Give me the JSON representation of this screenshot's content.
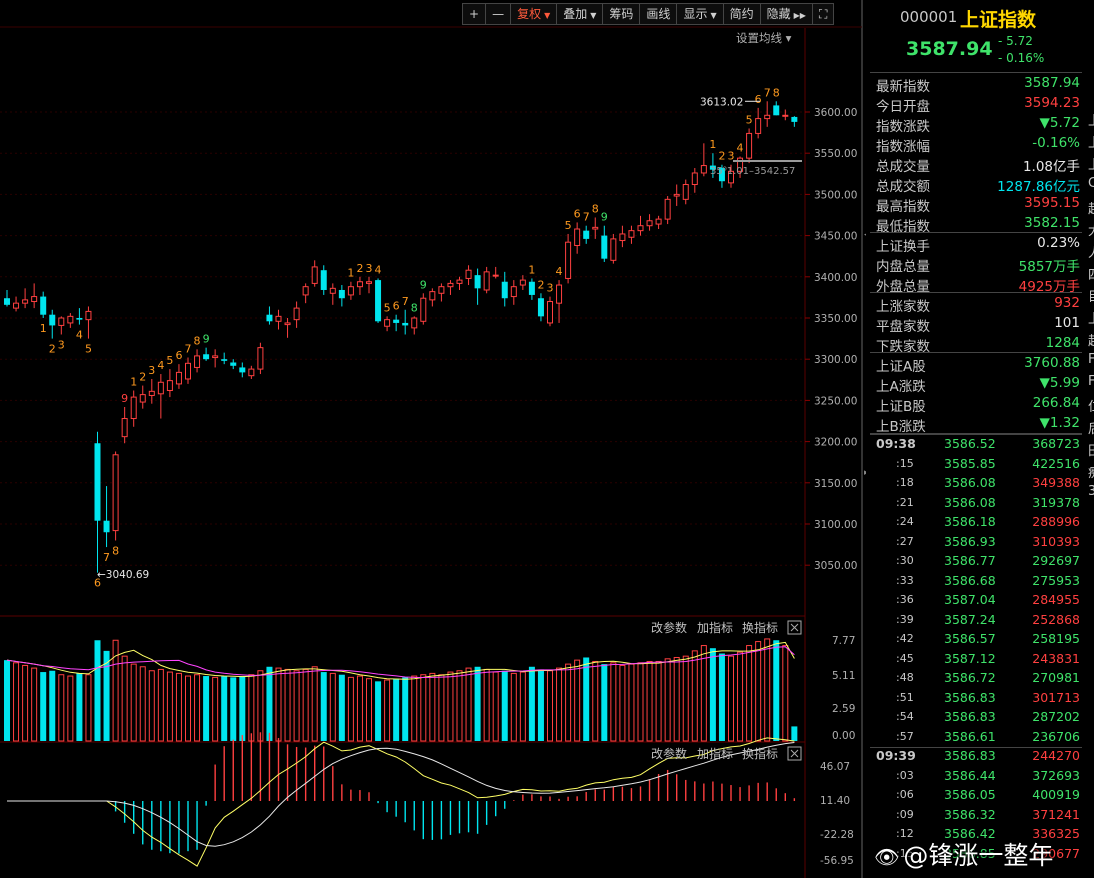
{
  "toolbar": [
    "+",
    "—",
    "复权",
    "叠加",
    "筹码",
    "画线",
    "显示",
    "简约",
    "隐藏",
    "⛶"
  ],
  "toolbar_active": "复权",
  "toolbar_dropdowns": [
    "复权",
    "叠加",
    "显示"
  ],
  "icons": {
    "expand": "expand-icon",
    "hide_arrow": "double-arrow-right-icon",
    "close": "close-icon"
  },
  "colors": {
    "up": "#ff4040",
    "down": "#00e5ee",
    "bg": "#000000",
    "ma5": "#ffff66",
    "ma10": "#ff44ff",
    "label_orange": "#ff9a1f",
    "label_green": "#3fe36a"
  },
  "main": {
    "settings_label": "设置均线",
    "price_axis": [
      "3600.00",
      "3550.00",
      "3500.00",
      "3450.00",
      "3400.00",
      "3350.00",
      "3300.00",
      "3250.00",
      "3200.00",
      "3150.00",
      "3100.00",
      "3050.00"
    ],
    "annotation_high": "3613.02",
    "annotation_low": "3040.69",
    "annotation_range": "35⁰1.01–3542.57"
  },
  "volume": {
    "controls": [
      "改参数",
      "加指标",
      "换指标"
    ],
    "axis": [
      "7.77",
      "5.11",
      "2.59",
      "0.00"
    ]
  },
  "macd": {
    "controls": [
      "改参数",
      "加指标",
      "换指标"
    ],
    "axis": [
      "46.07",
      "11.40",
      "-22.28",
      "-56.95"
    ]
  },
  "quote": {
    "code": "000001",
    "name": "上证指数",
    "price": "3587.94",
    "change": "- 5.72",
    "change_pct": "- 0.16%",
    "rows": [
      {
        "label": "最新指数",
        "value": "3587.94",
        "color": "green"
      },
      {
        "label": "今日开盘",
        "value": "3594.23",
        "color": "red"
      },
      {
        "label": "指数涨跌",
        "value": "▼5.72",
        "color": "green"
      },
      {
        "label": "指数涨幅",
        "value": "-0.16%",
        "color": "green"
      },
      {
        "label": "总成交量",
        "value": "1.08亿手",
        "color": "white"
      },
      {
        "label": "总成交额",
        "value": "1287.86亿元",
        "color": "cyan"
      },
      {
        "label": "最高指数",
        "value": "3595.15",
        "color": "red"
      },
      {
        "label": "最低指数",
        "value": "3582.15",
        "color": "green"
      },
      {
        "label": "上证换手",
        "value": "0.23%",
        "color": "white"
      },
      {
        "label": "内盘总量",
        "value": "5857万手",
        "color": "green"
      },
      {
        "label": "外盘总量",
        "value": "4925万手",
        "color": "red"
      },
      {
        "label": "上涨家数",
        "value": "932",
        "color": "red"
      },
      {
        "label": "平盘家数",
        "value": "101",
        "color": "white"
      },
      {
        "label": "下跌家数",
        "value": "1284",
        "color": "green"
      },
      {
        "label": "上证A股",
        "value": "3760.88",
        "color": "green"
      },
      {
        "label": "上A涨跌",
        "value": "▼5.99",
        "color": "green"
      },
      {
        "label": "上证B股",
        "value": "266.84",
        "color": "green"
      },
      {
        "label": "上B涨跌",
        "value": "▼1.32",
        "color": "green"
      }
    ]
  },
  "ticks": [
    {
      "time": "09:38",
      "price": "3586.52",
      "vol": "368723",
      "vc": "green"
    },
    {
      "time": ":15",
      "price": "3585.85",
      "vol": "422516",
      "vc": "green"
    },
    {
      "time": ":18",
      "price": "3586.08",
      "vol": "349388",
      "vc": "red"
    },
    {
      "time": ":21",
      "price": "3586.08",
      "vol": "319378",
      "vc": "green"
    },
    {
      "time": ":24",
      "price": "3586.18",
      "vol": "288996",
      "vc": "red"
    },
    {
      "time": ":27",
      "price": "3586.93",
      "vol": "310393",
      "vc": "red"
    },
    {
      "time": ":30",
      "price": "3586.77",
      "vol": "292697",
      "vc": "green"
    },
    {
      "time": ":33",
      "price": "3586.68",
      "vol": "275953",
      "vc": "green"
    },
    {
      "time": ":36",
      "price": "3587.04",
      "vol": "284955",
      "vc": "red"
    },
    {
      "time": ":39",
      "price": "3587.24",
      "vol": "252868",
      "vc": "red"
    },
    {
      "time": ":42",
      "price": "3586.57",
      "vol": "258195",
      "vc": "green"
    },
    {
      "time": ":45",
      "price": "3587.12",
      "vol": "243831",
      "vc": "red"
    },
    {
      "time": ":48",
      "price": "3586.72",
      "vol": "270981",
      "vc": "green"
    },
    {
      "time": ":51",
      "price": "3586.83",
      "vol": "301713",
      "vc": "red"
    },
    {
      "time": ":54",
      "price": "3586.83",
      "vol": "287202",
      "vc": "green"
    },
    {
      "time": ":57",
      "price": "3586.61",
      "vol": "236706",
      "vc": "green"
    },
    {
      "time": "09:39",
      "price": "3586.83",
      "vol": "244270",
      "vc": "red"
    },
    {
      "time": ":03",
      "price": "3586.44",
      "vol": "372693",
      "vc": "green"
    },
    {
      "time": ":06",
      "price": "3586.05",
      "vol": "400919",
      "vc": "green"
    },
    {
      "time": ":09",
      "price": "3586.32",
      "vol": "371241",
      "vc": "red"
    },
    {
      "time": ":12",
      "price": "3586.42",
      "vol": "336325",
      "vc": "red"
    },
    {
      "time": ":15",
      "price": "3586.85",
      "vol": "290677",
      "vc": "red"
    }
  ],
  "edge_chars": [
    "上",
    "上",
    "上",
    "C",
    "起",
    "大",
    "人",
    "四",
    "目",
    "上",
    "起",
    "F",
    "F",
    "仁",
    "后",
    "田",
    "痴",
    "3"
  ],
  "watermark": "@锋涨一整年",
  "chart_data": {
    "type": "candlestick",
    "candles": [
      [
        3374,
        3384,
        3364,
        3366
      ],
      [
        3362,
        3376,
        3358,
        3368
      ],
      [
        3368,
        3386,
        3362,
        3372
      ],
      [
        3370,
        3392,
        3362,
        3376
      ],
      [
        3376,
        3382,
        3350,
        3354
      ],
      [
        3354,
        3360,
        3325,
        3341
      ],
      [
        3341,
        3352,
        3330,
        3350
      ],
      [
        3344,
        3356,
        3338,
        3352
      ],
      [
        3350,
        3362,
        3342,
        3348
      ],
      [
        3348,
        3364,
        3325,
        3358
      ],
      [
        3198,
        3212,
        3041,
        3104
      ],
      [
        3104,
        3146,
        3072,
        3090
      ],
      [
        3092,
        3188,
        3080,
        3184
      ],
      [
        3206,
        3242,
        3198,
        3228
      ],
      [
        3228,
        3262,
        3218,
        3254
      ],
      [
        3248,
        3268,
        3240,
        3257
      ],
      [
        3256,
        3276,
        3246,
        3261
      ],
      [
        3258,
        3282,
        3228,
        3272
      ],
      [
        3262,
        3288,
        3254,
        3274
      ],
      [
        3270,
        3294,
        3264,
        3284
      ],
      [
        3276,
        3302,
        3270,
        3295
      ],
      [
        3290,
        3312,
        3284,
        3304
      ],
      [
        3306,
        3314,
        3298,
        3300
      ],
      [
        3302,
        3312,
        3290,
        3304
      ],
      [
        3300,
        3308,
        3294,
        3298
      ],
      [
        3296,
        3300,
        3288,
        3292
      ],
      [
        3290,
        3296,
        3278,
        3284
      ],
      [
        3280,
        3292,
        3276,
        3288
      ],
      [
        3288,
        3320,
        3282,
        3314
      ],
      [
        3354,
        3364,
        3342,
        3346
      ],
      [
        3346,
        3360,
        3336,
        3352
      ],
      [
        3342,
        3350,
        3326,
        3344
      ],
      [
        3348,
        3370,
        3338,
        3362
      ],
      [
        3378,
        3392,
        3368,
        3388
      ],
      [
        3392,
        3420,
        3388,
        3412
      ],
      [
        3408,
        3414,
        3378,
        3384
      ],
      [
        3380,
        3392,
        3366,
        3386
      ],
      [
        3384,
        3390,
        3364,
        3374
      ],
      [
        3378,
        3394,
        3372,
        3388
      ],
      [
        3388,
        3400,
        3378,
        3394
      ],
      [
        3392,
        3400,
        3380,
        3394
      ],
      [
        3396,
        3398,
        3344,
        3346
      ],
      [
        3340,
        3352,
        3334,
        3348
      ],
      [
        3348,
        3354,
        3334,
        3344
      ],
      [
        3344,
        3360,
        3330,
        3341
      ],
      [
        3338,
        3352,
        3330,
        3350
      ],
      [
        3346,
        3380,
        3342,
        3374
      ],
      [
        3372,
        3386,
        3364,
        3382
      ],
      [
        3380,
        3392,
        3370,
        3388
      ],
      [
        3388,
        3396,
        3378,
        3392
      ],
      [
        3392,
        3400,
        3384,
        3396
      ],
      [
        3398,
        3414,
        3390,
        3408
      ],
      [
        3402,
        3410,
        3366,
        3386
      ],
      [
        3384,
        3412,
        3380,
        3406
      ],
      [
        3402,
        3412,
        3398,
        3402
      ],
      [
        3394,
        3406,
        3364,
        3374
      ],
      [
        3376,
        3396,
        3366,
        3388
      ],
      [
        3390,
        3402,
        3384,
        3396
      ],
      [
        3394,
        3398,
        3372,
        3378
      ],
      [
        3374,
        3380,
        3346,
        3352
      ],
      [
        3344,
        3376,
        3340,
        3370
      ],
      [
        3368,
        3396,
        3344,
        3390
      ],
      [
        3398,
        3452,
        3392,
        3442
      ],
      [
        3438,
        3466,
        3428,
        3458
      ],
      [
        3456,
        3462,
        3440,
        3446
      ],
      [
        3458,
        3472,
        3446,
        3460
      ],
      [
        3450,
        3462,
        3418,
        3422
      ],
      [
        3420,
        3452,
        3416,
        3446
      ],
      [
        3444,
        3462,
        3436,
        3452
      ],
      [
        3448,
        3462,
        3440,
        3456
      ],
      [
        3456,
        3474,
        3450,
        3462
      ],
      [
        3462,
        3476,
        3456,
        3468
      ],
      [
        3464,
        3474,
        3458,
        3470
      ],
      [
        3470,
        3498,
        3464,
        3494
      ],
      [
        3498,
        3512,
        3486,
        3500
      ],
      [
        3494,
        3518,
        3488,
        3512
      ],
      [
        3512,
        3532,
        3502,
        3526
      ],
      [
        3526,
        3562,
        3522,
        3535
      ],
      [
        3535,
        3550,
        3520,
        3530
      ],
      [
        3532,
        3536,
        3508,
        3516
      ],
      [
        3514,
        3536,
        3508,
        3528
      ],
      [
        3528,
        3546,
        3520,
        3544
      ],
      [
        3544,
        3580,
        3538,
        3574
      ],
      [
        3574,
        3605,
        3568,
        3592
      ],
      [
        3592,
        3613,
        3582,
        3596
      ],
      [
        3608,
        3613,
        3596,
        3596
      ],
      [
        3596,
        3603,
        3590,
        3596
      ],
      [
        3594,
        3595,
        3582,
        3588
      ]
    ],
    "seq_labels": [
      {
        "i": 4,
        "n": 1,
        "c": "o",
        "pos": "b"
      },
      {
        "i": 5,
        "n": 2,
        "c": "o",
        "pos": "b"
      },
      {
        "i": 6,
        "n": 3,
        "c": "o",
        "pos": "b"
      },
      {
        "i": 8,
        "n": 4,
        "c": "o",
        "pos": "b"
      },
      {
        "i": 9,
        "n": 5,
        "c": "o",
        "pos": "b"
      },
      {
        "i": 10,
        "n": 6,
        "c": "o",
        "pos": "b"
      },
      {
        "i": 11,
        "n": 7,
        "c": "o",
        "pos": "b"
      },
      {
        "i": 12,
        "n": 8,
        "c": "o",
        "pos": "b"
      },
      {
        "i": 13,
        "n": 9,
        "c": "r",
        "pos": "t"
      },
      {
        "i": 14,
        "n": 1,
        "c": "o",
        "pos": "t"
      },
      {
        "i": 15,
        "n": 2,
        "c": "o",
        "pos": "t"
      },
      {
        "i": 16,
        "n": 3,
        "c": "o",
        "pos": "t"
      },
      {
        "i": 17,
        "n": 4,
        "c": "o",
        "pos": "t"
      },
      {
        "i": 18,
        "n": 5,
        "c": "o",
        "pos": "t"
      },
      {
        "i": 19,
        "n": 6,
        "c": "o",
        "pos": "t"
      },
      {
        "i": 20,
        "n": 7,
        "c": "o",
        "pos": "t"
      },
      {
        "i": 21,
        "n": 8,
        "c": "o",
        "pos": "t"
      },
      {
        "i": 22,
        "n": 9,
        "c": "g",
        "pos": "t"
      },
      {
        "i": 38,
        "n": 1,
        "c": "o",
        "pos": "t"
      },
      {
        "i": 39,
        "n": 2,
        "c": "o",
        "pos": "t"
      },
      {
        "i": 40,
        "n": 3,
        "c": "o",
        "pos": "t"
      },
      {
        "i": 41,
        "n": 4,
        "c": "o",
        "pos": "t"
      },
      {
        "i": 42,
        "n": 5,
        "c": "o",
        "pos": "t"
      },
      {
        "i": 43,
        "n": 6,
        "c": "o",
        "pos": "t"
      },
      {
        "i": 44,
        "n": 7,
        "c": "o",
        "pos": "t"
      },
      {
        "i": 45,
        "n": 8,
        "c": "g",
        "pos": "t"
      },
      {
        "i": 46,
        "n": 9,
        "c": "g",
        "pos": "t"
      },
      {
        "i": 58,
        "n": 1,
        "c": "o",
        "pos": "t"
      },
      {
        "i": 59,
        "n": 2,
        "c": "o",
        "pos": "t"
      },
      {
        "i": 60,
        "n": 3,
        "c": "o",
        "pos": "t"
      },
      {
        "i": 61,
        "n": 4,
        "c": "o",
        "pos": "t"
      },
      {
        "i": 62,
        "n": 5,
        "c": "o",
        "pos": "t"
      },
      {
        "i": 63,
        "n": 6,
        "c": "o",
        "pos": "t"
      },
      {
        "i": 64,
        "n": 7,
        "c": "o",
        "pos": "t"
      },
      {
        "i": 65,
        "n": 8,
        "c": "o",
        "pos": "t"
      },
      {
        "i": 66,
        "n": 9,
        "c": "g",
        "pos": "t"
      },
      {
        "i": 78,
        "n": 1,
        "c": "o",
        "pos": "t"
      },
      {
        "i": 79,
        "n": 2,
        "c": "o",
        "pos": "t"
      },
      {
        "i": 80,
        "n": 3,
        "c": "o",
        "pos": "t"
      },
      {
        "i": 81,
        "n": 4,
        "c": "o",
        "pos": "t"
      },
      {
        "i": 82,
        "n": 5,
        "c": "o",
        "pos": "t"
      },
      {
        "i": 83,
        "n": 6,
        "c": "o",
        "pos": "t"
      },
      {
        "i": 84,
        "n": 7,
        "c": "o",
        "pos": "t"
      },
      {
        "i": 85,
        "n": 8,
        "c": "o",
        "pos": "t"
      }
    ],
    "volume": [
      6.1,
      5.9,
      5.7,
      5.5,
      5.2,
      5.3,
      5.0,
      4.9,
      5.1,
      5.0,
      7.6,
      6.8,
      7.6,
      6.4,
      5.8,
      5.6,
      5.3,
      5.4,
      5.2,
      5.1,
      4.9,
      5.0,
      4.9,
      4.8,
      4.9,
      4.8,
      4.9,
      5.0,
      5.3,
      5.6,
      5.5,
      5.4,
      5.3,
      5.4,
      5.6,
      5.2,
      5.1,
      5.0,
      4.8,
      4.9,
      4.7,
      4.5,
      4.6,
      4.7,
      4.8,
      4.9,
      5.0,
      5.1,
      5.0,
      5.2,
      5.3,
      5.5,
      5.6,
      5.4,
      5.2,
      5.3,
      5.1,
      5.2,
      5.6,
      5.4,
      5.3,
      5.5,
      5.8,
      6.1,
      6.3,
      6.0,
      5.8,
      5.9,
      5.7,
      5.8,
      5.9,
      6.0,
      6.0,
      6.2,
      6.3,
      6.4,
      6.8,
      7.2,
      7.0,
      6.6,
      6.4,
      6.7,
      7.2,
      7.5,
      7.7,
      7.6,
      7.2,
      1.1
    ],
    "volume_axis_range": [
      0,
      7.77
    ],
    "macd_axis_range": [
      -56.95,
      46.07
    ]
  }
}
